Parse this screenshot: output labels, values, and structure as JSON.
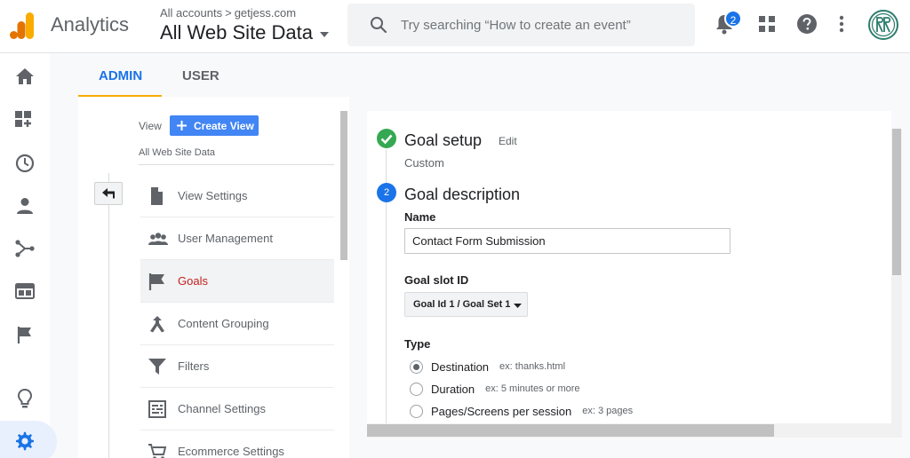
{
  "header": {
    "product_name": "Analytics",
    "breadcrumb": {
      "account": "All accounts",
      "separator": ">",
      "property": "getjess.com"
    },
    "view_selector": "All Web Site Data",
    "search": {
      "placeholder": "Try searching “How to create an event”"
    },
    "notifications_count": "2",
    "icons": [
      "analytics-logo-icon",
      "search-icon",
      "bell-icon",
      "apps-grid-icon",
      "help-icon",
      "more-vert-icon",
      "avatar-rr-icon"
    ]
  },
  "rail": {
    "icons": [
      "home-icon",
      "customization-icon",
      "realtime-clock-icon",
      "audience-person-icon",
      "acquisition-icon",
      "behavior-icon",
      "conversions-flag-icon",
      "insights-bulb-icon",
      "admin-gear-icon"
    ],
    "active": "admin-gear-icon"
  },
  "tabs": [
    {
      "label": "ADMIN",
      "active": true
    },
    {
      "label": "USER",
      "active": false
    }
  ],
  "admin_column": {
    "view_label": "View",
    "create_view_label": "Create View",
    "view_name": "All Web Site Data",
    "menu": [
      {
        "label": "View Settings",
        "icon": "document-icon",
        "active": false
      },
      {
        "label": "User Management",
        "icon": "people-icon",
        "active": false
      },
      {
        "label": "Goals",
        "icon": "flag-icon",
        "active": true
      },
      {
        "label": "Content Grouping",
        "icon": "merge-icon",
        "active": false
      },
      {
        "label": "Filters",
        "icon": "filter-icon",
        "active": false
      },
      {
        "label": "Channel Settings",
        "icon": "channel-settings-icon",
        "active": false
      },
      {
        "label": "Ecommerce Settings",
        "icon": "cart-icon",
        "active": false
      }
    ]
  },
  "goal_panel": {
    "step1": {
      "title": "Goal setup",
      "edit_label": "Edit",
      "subtitle": "Custom"
    },
    "step2": {
      "number": "2",
      "title": "Goal description",
      "name_label": "Name",
      "name_value": "Contact Form Submission",
      "slot_label": "Goal slot ID",
      "slot_value": "Goal Id 1 / Goal Set 1",
      "type_label": "Type",
      "types": [
        {
          "label": "Destination",
          "hint": "ex: thanks.html",
          "checked": true
        },
        {
          "label": "Duration",
          "hint": "ex: 5 minutes or more",
          "checked": false
        },
        {
          "label": "Pages/Screens per session",
          "hint": "ex: 3 pages",
          "checked": false
        }
      ]
    }
  },
  "colors": {
    "accent": "#1a73e8",
    "success": "#34a853",
    "active_item": "#c5221f",
    "tab_underline": "#f9ab00",
    "logo_orange": "#f9ab00",
    "logo_dark": "#e37400"
  }
}
